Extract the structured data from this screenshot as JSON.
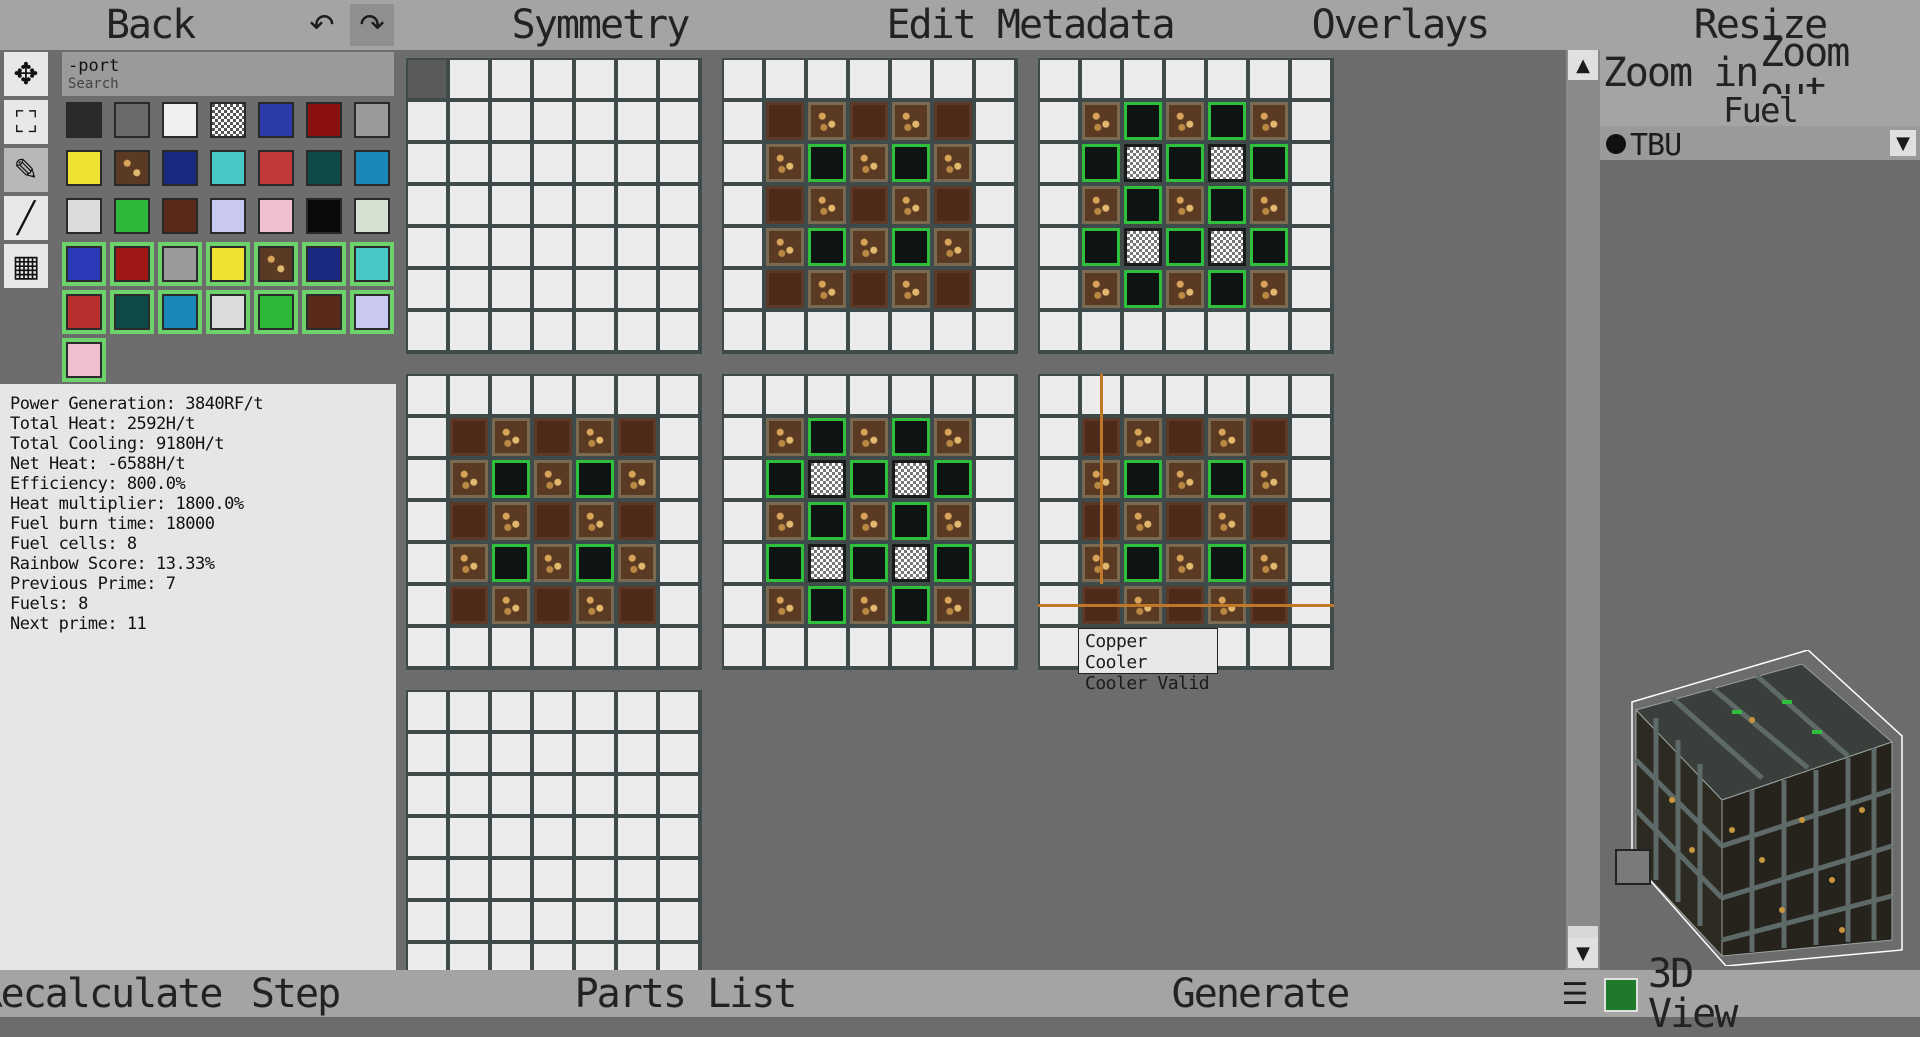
{
  "toolbar": {
    "back": "Back",
    "undo_icon": "undo-arrow-icon",
    "redo_icon": "redo-arrow-icon",
    "symmetry": "Symmetry",
    "edit_metadata": "Edit Metadata",
    "overlays": "Overlays",
    "resize": "Resize"
  },
  "tools": [
    "move-icon",
    "select-icon",
    "pencil-icon",
    "line-icon",
    "grid-icon"
  ],
  "palette": {
    "search_value": "-port",
    "search_placeholder": "Search"
  },
  "stats": {
    "lines": [
      "Power Generation: 3840RF/t",
      "Total Heat: 2592H/t",
      "Total Cooling: 9180H/t",
      "Net Heat: -6588H/t",
      "Efficiency: 800.0%",
      "Heat multiplier: 1800.0%",
      "Fuel burn time: 18000",
      "Fuel cells: 8",
      "Rainbow Score: 13.33%",
      "Previous Prime: 7",
      "Fuels: 8",
      "Next prime: 11"
    ]
  },
  "tooltip": {
    "line1": "Copper Cooler",
    "line2": "Cooler Valid"
  },
  "right_panel": {
    "zoom_in": "Zoom in",
    "zoom_out": "Zoom out",
    "fuel_label": "Fuel",
    "fuel_selected": "TBU"
  },
  "bottombar": {
    "recalculate": "Recalculate",
    "step": "Step",
    "parts_list": "Parts List",
    "generate": "Generate",
    "view3d": "3D View"
  },
  "colors": {
    "bar": "#a4a4a4",
    "background": "#6c6c6c",
    "valid_green": "#2fbf3a",
    "copper": "#4d2a1a",
    "crosshair": "#c07828"
  }
}
